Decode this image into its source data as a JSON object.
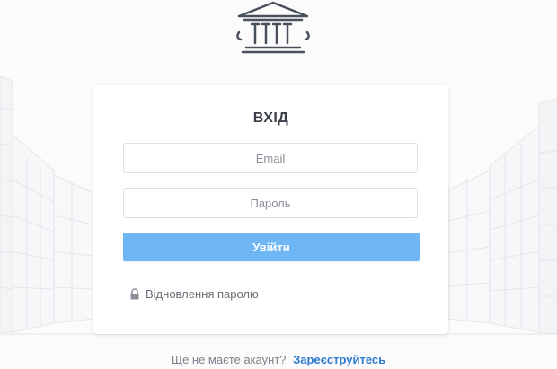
{
  "logo": {
    "icon": "institution-columns-icon",
    "color": "#4a4f5c"
  },
  "login_card": {
    "title": "ВХІД",
    "email_placeholder": "Email",
    "password_placeholder": "Пароль",
    "submit_label": "Увійти",
    "recover_icon": "lock-icon",
    "recover_label": "Відновлення паролю"
  },
  "footer": {
    "question": "Ще не маєте акаунт?",
    "signup_link": "Зареєструйтесь"
  },
  "colors": {
    "accent_button": "#6fb6f4",
    "link": "#2e7bd1",
    "title_text": "#3b3f48"
  }
}
